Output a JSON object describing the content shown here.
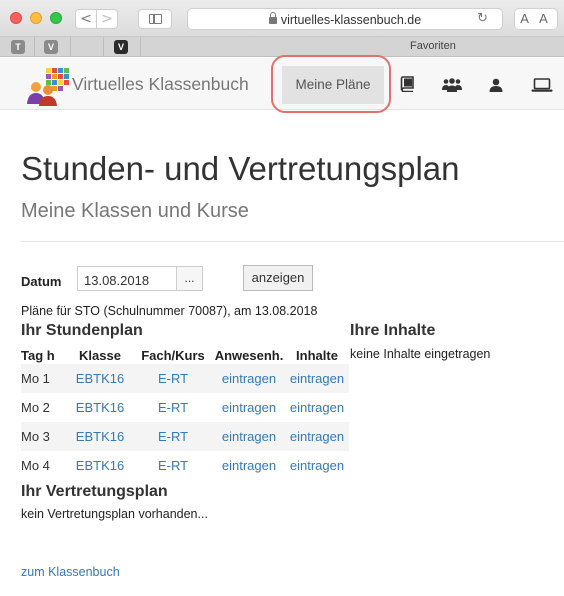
{
  "browser": {
    "url": "virtuelles-klassenbuch.de",
    "reader_label": "A A",
    "back_glyph": "<",
    "forward_glyph": ">",
    "reload_glyph": "↻",
    "favorites_label": "Favoriten",
    "tabs": [
      "T",
      "V",
      "V"
    ]
  },
  "navbar": {
    "brand": "Virtuelles Klassenbuch",
    "active_item": "Meine Pläne",
    "icons": [
      "book-icon",
      "group-icon",
      "user-icon",
      "laptop-icon"
    ]
  },
  "page": {
    "title": "Stunden- und Vertretungsplan",
    "subtitle": "Meine Klassen und Kurse"
  },
  "form": {
    "date_label": "Datum",
    "date_value": "13.08.2018",
    "picker_label": "...",
    "show_label": "anzeigen"
  },
  "info_line": "Pläne für STO (Schulnummer 70087), am 13.08.2018",
  "stundenplan": {
    "heading": "Ihr Stundenplan",
    "columns": [
      "Tag h",
      "Klasse",
      "Fach/Kurs",
      "Anwesenh.",
      "Inhalte"
    ],
    "rows": [
      {
        "tag": "Mo 1",
        "klasse": "EBTK16",
        "fach": "E-RT",
        "anwesenheit": "eintragen",
        "inhalte": "eintragen"
      },
      {
        "tag": "Mo 2",
        "klasse": "EBTK16",
        "fach": "E-RT",
        "anwesenheit": "eintragen",
        "inhalte": "eintragen"
      },
      {
        "tag": "Mo 3",
        "klasse": "EBTK16",
        "fach": "E-RT",
        "anwesenheit": "eintragen",
        "inhalte": "eintragen"
      },
      {
        "tag": "Mo 4",
        "klasse": "EBTK16",
        "fach": "E-RT",
        "anwesenheit": "eintragen",
        "inhalte": "eintragen"
      }
    ]
  },
  "inhalte": {
    "heading": "Ihre Inhalte",
    "text": "keine Inhalte eingetragen"
  },
  "vertretungsplan": {
    "heading": "Ihr Vertretungsplan",
    "text": "kein Vertretungsplan vorhanden..."
  },
  "footer": {
    "link": "zum Klassenbuch"
  },
  "colors": {
    "link": "#337ab7",
    "highlight_ring": "#e3706a"
  }
}
